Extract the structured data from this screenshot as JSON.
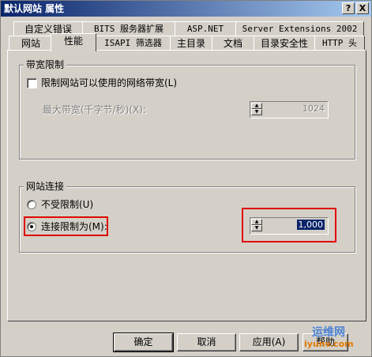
{
  "window": {
    "title": "默认网站 属性",
    "help_label": "?",
    "close_label": "X"
  },
  "tabs_back": [
    {
      "label": "自定义错误"
    },
    {
      "label": "BITS 服务器扩展"
    },
    {
      "label": "ASP.NET"
    },
    {
      "label": "Server Extensions 2002"
    }
  ],
  "tabs_front": [
    {
      "label": "网站"
    },
    {
      "label": "性能"
    },
    {
      "label": "ISAPI 筛选器"
    },
    {
      "label": "主目录"
    },
    {
      "label": "文档"
    },
    {
      "label": "目录安全性"
    },
    {
      "label": "HTTP 头"
    }
  ],
  "bandwidth": {
    "group_title": "带宽限制",
    "checkbox_label": "限制网站可以使用的网络带宽(L)",
    "checked": false,
    "max_label": "最大带宽(千字节/秒)(X):",
    "max_value": "1024"
  },
  "connections": {
    "group_title": "网站连接",
    "unlimited_label": "不受限制(U)",
    "limited_label": "连接限制为(M):",
    "limit_value": "1,000"
  },
  "buttons": {
    "ok": "确定",
    "cancel": "取消",
    "apply": "应用(A)",
    "help": "帮助"
  },
  "watermark": {
    "line1": "运维网",
    "line2": "iyunv.com"
  }
}
